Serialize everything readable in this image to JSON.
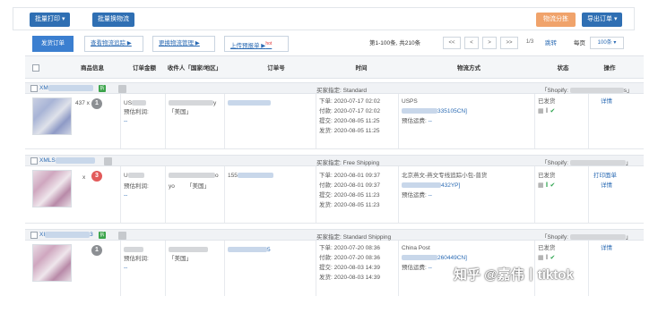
{
  "toolbar": {
    "batch_print": "批量打印 ▾",
    "batch_logistics": "批量换物流",
    "logistics_split": "物流分拣",
    "export_orders": "导出订单 ▾"
  },
  "tabs": [
    {
      "label": "发货订单"
    },
    {
      "label": "查看物流追踪 ▶"
    },
    {
      "label": "更换物流管理 ▶"
    },
    {
      "label": "上传预报单 ▶",
      "badge": "hot"
    }
  ],
  "pager": {
    "summary": "第1-100条, 共210条",
    "first": "<<",
    "prev": "<",
    "next": ">",
    "last": ">>",
    "page": "1/3",
    "jump": "跳转",
    "per_page_label": "每页",
    "per_page_value": "100条 ▾"
  },
  "columns": {
    "product": "商品信息",
    "amount": "订单金额",
    "recipient": "收件人「国家/地区」",
    "order_no": "订单号",
    "time": "时间",
    "shipping": "物流方式",
    "status": "状态",
    "action": "操作"
  },
  "orders": [
    {
      "prefix": "XM",
      "tag": "拆",
      "buyer_label": "买家指定:",
      "buyer_value": "Standard",
      "shop_label": "「Shopify:",
      "shop_end": "s」",
      "qty": "437 x",
      "badge": "1",
      "amount_prefix": "US",
      "profit_label": "预估利润:",
      "profit_value": "--",
      "recip_tail": "y",
      "country": "「美国」",
      "times": [
        {
          "label": "下单:",
          "value": "2020-07-17 02:02"
        },
        {
          "label": "付款:",
          "value": "2020-07-17 02:02"
        },
        {
          "label": "提交:",
          "value": "2020-08-05 11:25"
        },
        {
          "label": "发货:",
          "value": "2020-08-05 11:25"
        }
      ],
      "carrier": "USPS",
      "tracking_tail": "335105CN]",
      "freight_label": "预估运费:",
      "freight_value": "--",
      "status": "已发货",
      "action": "详情"
    },
    {
      "prefix": "XMLS",
      "tag": "",
      "buyer_label": "买家指定:",
      "buyer_value": "Free Shipping",
      "shop_label": "「Shopify:",
      "shop_end": "」",
      "qty": "x",
      "badge": "3",
      "amount_prefix": "U",
      "profit_label": "预估利润:",
      "profit_value": "--",
      "recip_tail": "o",
      "recip_line2": "yo",
      "country": "「美国」",
      "order_prefix": "155",
      "times": [
        {
          "label": "下单:",
          "value": "2020-08-01 09:37"
        },
        {
          "label": "付款:",
          "value": "2020-08-01 09:37"
        },
        {
          "label": "提交:",
          "value": "2020-08-05 11:23"
        },
        {
          "label": "发货:",
          "value": "2020-08-05 11:23"
        }
      ],
      "carrier": "北京燕文-燕文专线追踪小包-普货",
      "tracking_tail": "432YP]",
      "freight_label": "预估运费:",
      "freight_value": "--",
      "status": "已发货",
      "action": "打印面单",
      "action2": "详情"
    },
    {
      "prefix": "XI",
      "prefix_tail": "3",
      "tag": "拆",
      "buyer_label": "买家指定:",
      "buyer_value": "Standard Shipping",
      "shop_label": "「Shopify:",
      "shop_end": "」",
      "qty": "",
      "badge": "1",
      "amount_prefix": "",
      "profit_label": "预估利润:",
      "profit_value": "--",
      "recip_tail": "",
      "country": "「美国」",
      "order_tail": "5",
      "times": [
        {
          "label": "下单:",
          "value": "2020-07-20 08:36"
        },
        {
          "label": "付款:",
          "value": "2020-07-20 08:36"
        },
        {
          "label": "提交:",
          "value": "2020-08-03 14:39"
        },
        {
          "label": "发货:",
          "value": "2020-08-03 14:39"
        }
      ],
      "carrier": "China Post",
      "tracking_tail": "260449CN]",
      "freight_label": "预估运费:",
      "freight_value": "--",
      "status": "已发货",
      "action": "详情"
    }
  ],
  "watermark": "知乎 @嘉伟丨tiktok"
}
